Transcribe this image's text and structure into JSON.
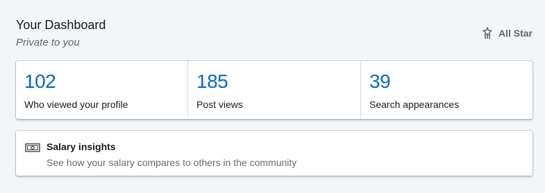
{
  "dashboard": {
    "title": "Your Dashboard",
    "subtitle": "Private to you",
    "badge": {
      "label": "All Star",
      "icon": "all-star-icon"
    },
    "stats": [
      {
        "value": "102",
        "label": "Who viewed your profile"
      },
      {
        "value": "185",
        "label": "Post views"
      },
      {
        "value": "39",
        "label": "Search appearances"
      }
    ],
    "salary": {
      "icon": "money-icon",
      "title": "Salary insights",
      "description": "See how your salary compares to others in the community"
    }
  },
  "colors": {
    "background": "#f3f6f8",
    "card": "#ffffff",
    "accent": "#0a66c2"
  }
}
